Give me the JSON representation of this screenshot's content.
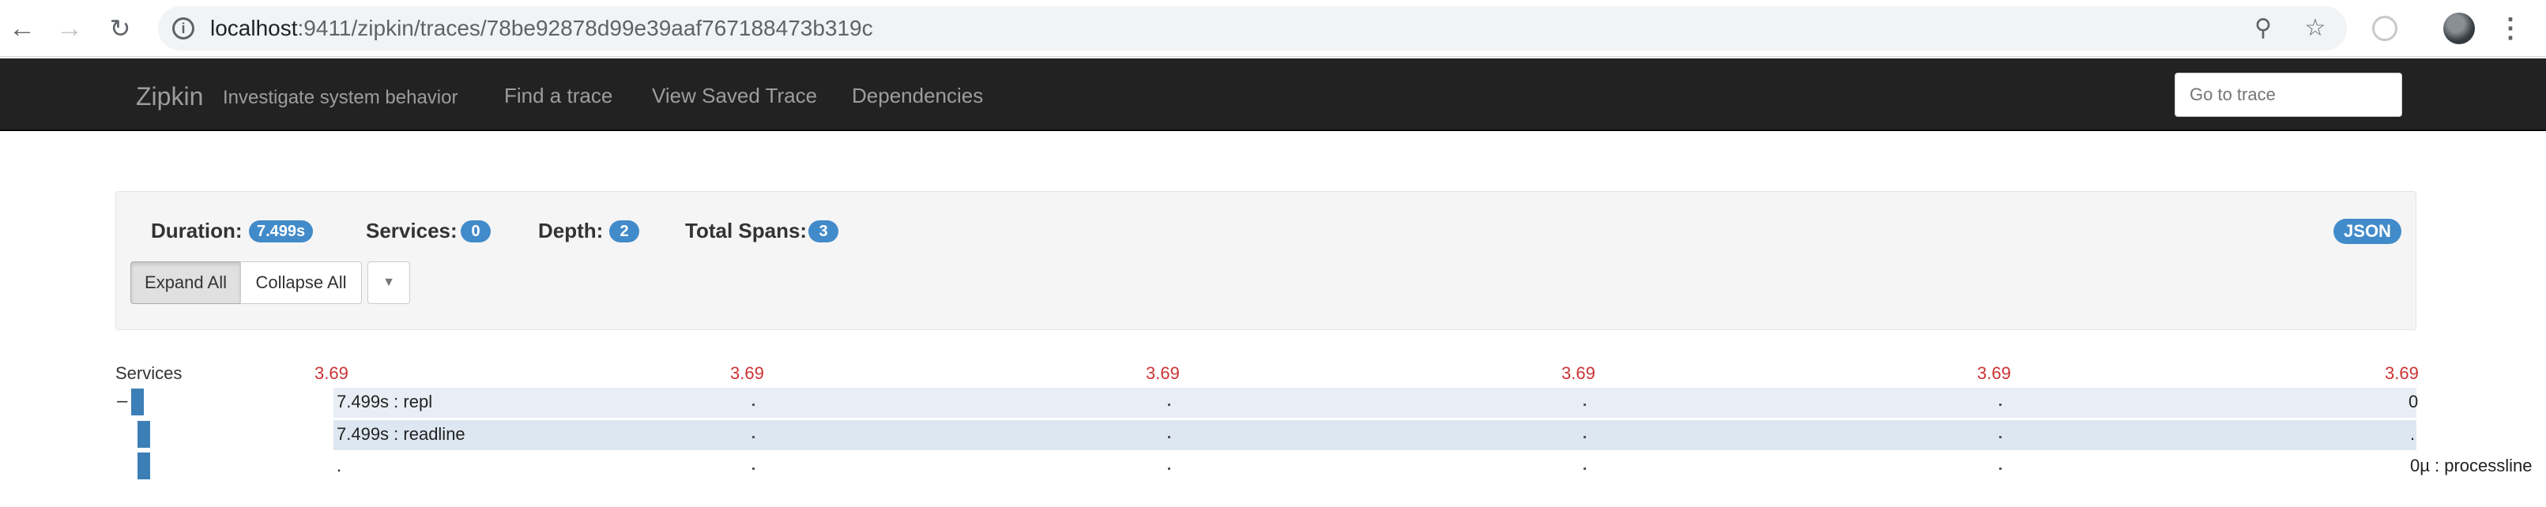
{
  "browser": {
    "url_host": "localhost",
    "url_path": ":9411/zipkin/traces/78be92878d99e39aaf767188473b319c",
    "back_icon": "arrow-left-icon",
    "forward_icon": "arrow-right-icon",
    "reload_icon": "reload-icon",
    "info_icon": "info-icon",
    "zoom_icon": "zoom-icon",
    "bookmark_icon": "star-icon",
    "menu_icon": "vertical-dots-icon"
  },
  "navbar": {
    "brand": "Zipkin",
    "tagline": "Investigate system behavior",
    "links": [
      "Find a trace",
      "View Saved Trace",
      "Dependencies"
    ],
    "goto_placeholder": "Go to trace"
  },
  "summary": {
    "duration_label": "Duration:",
    "duration_value": "7.499s",
    "services_label": "Services:",
    "services_value": "0",
    "depth_label": "Depth:",
    "depth_value": "2",
    "total_spans_label": "Total Spans:",
    "total_spans_value": "3",
    "json_button": "JSON",
    "expand_all": "Expand All",
    "collapse_all": "Collapse All",
    "dropdown_icon": "caret-down-icon"
  },
  "timeline": {
    "services_header": "Services",
    "ticks": [
      "3.69",
      "3.69",
      "3.69",
      "3.69",
      "3.69",
      "3.69"
    ],
    "tick_color": "#cc3333",
    "bar_color": "#3c7fb6",
    "spans": [
      {
        "label": "7.499s : repl",
        "end_mark": "0",
        "toggle": "–"
      },
      {
        "label": "7.499s : readline",
        "end_mark": ".",
        "toggle": ""
      },
      {
        "label": ".",
        "end_mark": "0µ : processline",
        "toggle": ""
      }
    ]
  }
}
